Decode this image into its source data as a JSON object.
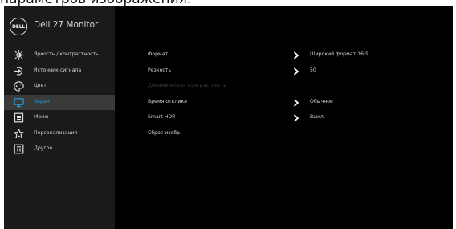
{
  "caption": "параметров изображения.",
  "osd": {
    "logo_text": "DELL",
    "title": "Dell 27 Monitor",
    "menu": [
      {
        "label": "Яркость / контрастность",
        "icon": "brightness-icon",
        "active": false
      },
      {
        "label": "Источник сигнала",
        "icon": "input-source-icon",
        "active": false
      },
      {
        "label": "Цвет",
        "icon": "color-palette-icon",
        "active": false
      },
      {
        "label": "Экран",
        "icon": "display-icon",
        "active": true
      },
      {
        "label": "Меню",
        "icon": "menu-icon",
        "active": false
      },
      {
        "label": "Персонализация",
        "icon": "star-icon",
        "active": false
      },
      {
        "label": "Другое",
        "icon": "other-info-icon",
        "active": false
      }
    ],
    "settings": [
      {
        "label": "Формат",
        "value": "Широкий формат 16:9",
        "has_arrow": true,
        "disabled": false
      },
      {
        "label": "Резкость",
        "value": "50",
        "has_arrow": true,
        "disabled": false
      },
      {
        "label": "Динамическая контрастность",
        "value": "",
        "has_arrow": false,
        "disabled": true
      },
      {
        "label": "Время отклика",
        "value": "Обычное",
        "has_arrow": true,
        "disabled": false
      },
      {
        "label": "Smart HDR",
        "value": "Выкл.",
        "has_arrow": true,
        "disabled": false
      },
      {
        "label": "Сброс изобр.",
        "value": "",
        "has_arrow": false,
        "disabled": false
      }
    ],
    "colors": {
      "background": "#000000",
      "sidebar": "#1a1a1a",
      "active_item_bg": "#3a3a3a",
      "active_text": "#2f9bd9",
      "text": "#d0d0d0",
      "disabled_text": "#3a3a3a"
    }
  }
}
